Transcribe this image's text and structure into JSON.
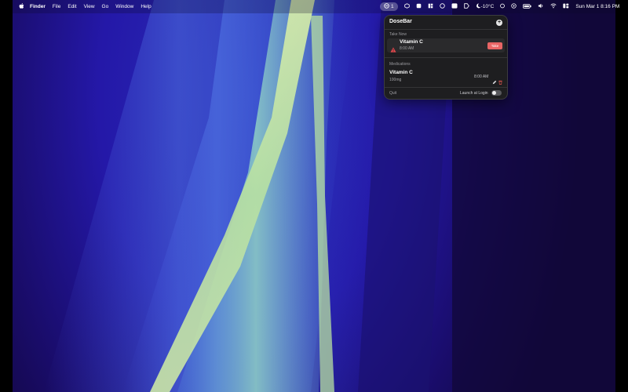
{
  "menubar": {
    "apple_icon": "apple-icon",
    "app_name": "Finder",
    "menus": [
      "File",
      "Edit",
      "View",
      "Go",
      "Window",
      "Help"
    ],
    "dosebar_count": "1",
    "weather": "-10°C",
    "clock": "Sun Mar 1  8:16 PM"
  },
  "popover": {
    "title": "DoseBar",
    "add_icon": "plus-icon",
    "take_now_label": "Take Now",
    "due": {
      "name": "Vitamin C",
      "time": "8:00 AM",
      "take_label": "Take",
      "warning_icon": "warning-icon"
    },
    "medications_label": "Medications",
    "medication": {
      "name": "Vitamin C",
      "dose": "100mg",
      "time": "8:00 AM",
      "edit_icon": "pencil-icon",
      "delete_icon": "trash-icon"
    },
    "quit_label": "Quit",
    "launch_label": "Launch at Login",
    "launch_enabled": false
  },
  "colors": {
    "accent_take": "#e86565",
    "warning": "#e5484d",
    "delete": "#d9534f",
    "popover_bg": "#1e1e20"
  }
}
